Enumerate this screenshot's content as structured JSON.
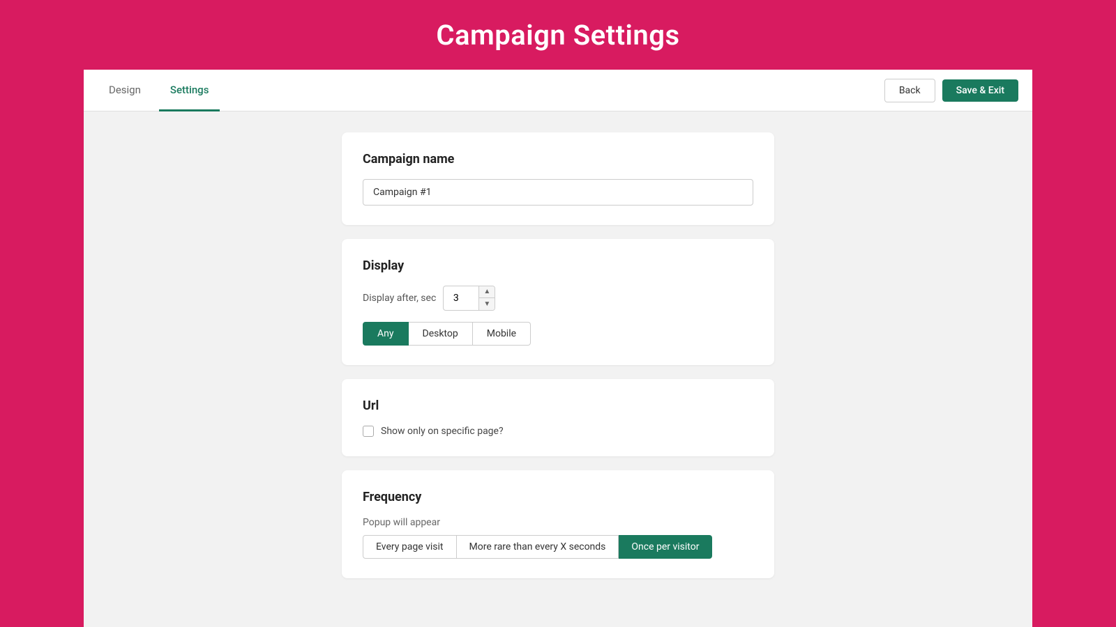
{
  "header": {
    "title": "Campaign Settings",
    "background": "#d81b60"
  },
  "tabs": {
    "items": [
      {
        "label": "Design",
        "active": false
      },
      {
        "label": "Settings",
        "active": true
      }
    ],
    "back_label": "Back",
    "save_label": "Save & Exit"
  },
  "campaign_name_card": {
    "title": "Campaign name",
    "input_value": "Campaign #1",
    "input_placeholder": "Campaign #1"
  },
  "display_card": {
    "title": "Display",
    "display_after_label": "Display after, sec",
    "display_after_value": "3",
    "devices": [
      {
        "label": "Any",
        "active": true
      },
      {
        "label": "Desktop",
        "active": false
      },
      {
        "label": "Mobile",
        "active": false
      }
    ]
  },
  "url_card": {
    "title": "Url",
    "checkbox_label": "Show only on specific page?",
    "checked": false
  },
  "frequency_card": {
    "title": "Frequency",
    "sublabel": "Popup will appear",
    "options": [
      {
        "label": "Every page visit",
        "active": false
      },
      {
        "label": "More rare than every X seconds",
        "active": false
      },
      {
        "label": "Once per visitor",
        "active": true
      }
    ]
  },
  "colors": {
    "primary": "#1a7a5e",
    "header_bg": "#d81b60"
  }
}
